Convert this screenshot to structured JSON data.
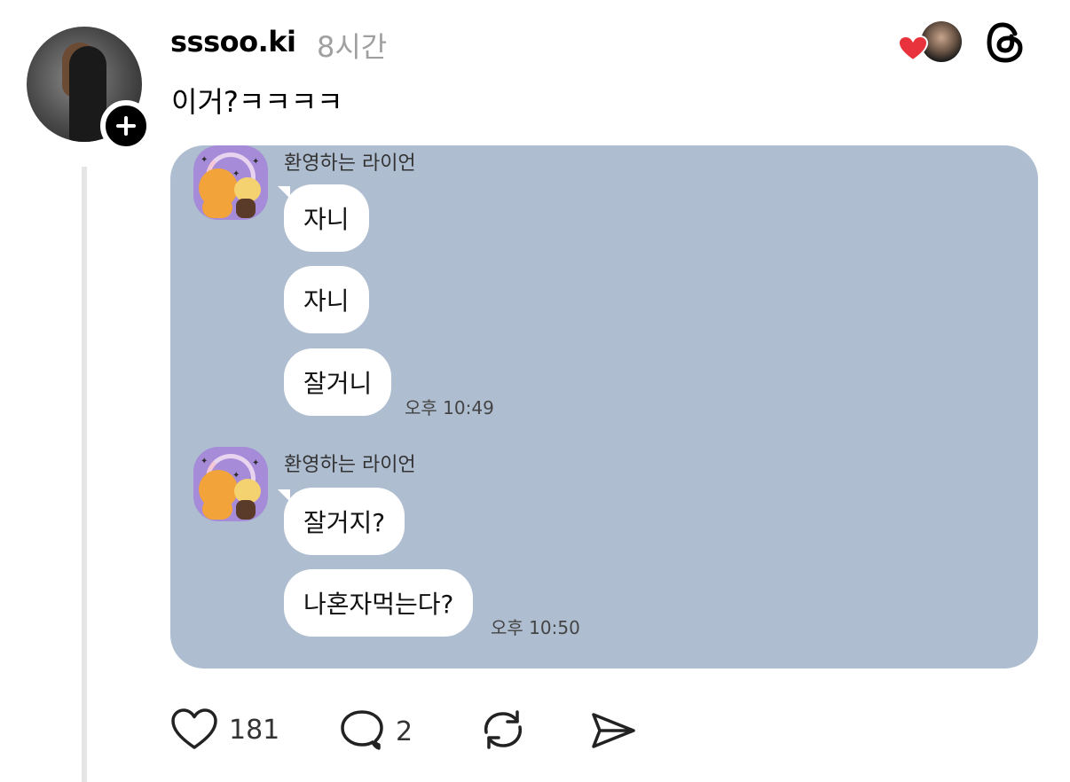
{
  "post": {
    "username": "sssoo.ki",
    "time": "8시간",
    "text": "이거?ㅋㅋㅋㅋ"
  },
  "chat": {
    "groups": [
      {
        "sender": "환영하는 라이언",
        "messages": [
          "자니",
          "자니",
          "잘거니"
        ],
        "timestamp": "오후 10:49"
      },
      {
        "sender": "환영하는 라이언",
        "messages": [
          "잘거지?",
          "나혼자먹는다?"
        ],
        "timestamp": "오후 10:50"
      }
    ]
  },
  "actions": {
    "likes": "181",
    "replies": "2"
  },
  "icons": {
    "like": "heart-icon",
    "reply": "comment-icon",
    "repost": "repost-icon",
    "share": "send-icon",
    "app": "threads-logo",
    "follow": "plus-icon"
  },
  "colors": {
    "chat_background": "#aebdd0",
    "liked_heart": "#e8323c",
    "muted_text": "#a0a0a0"
  }
}
